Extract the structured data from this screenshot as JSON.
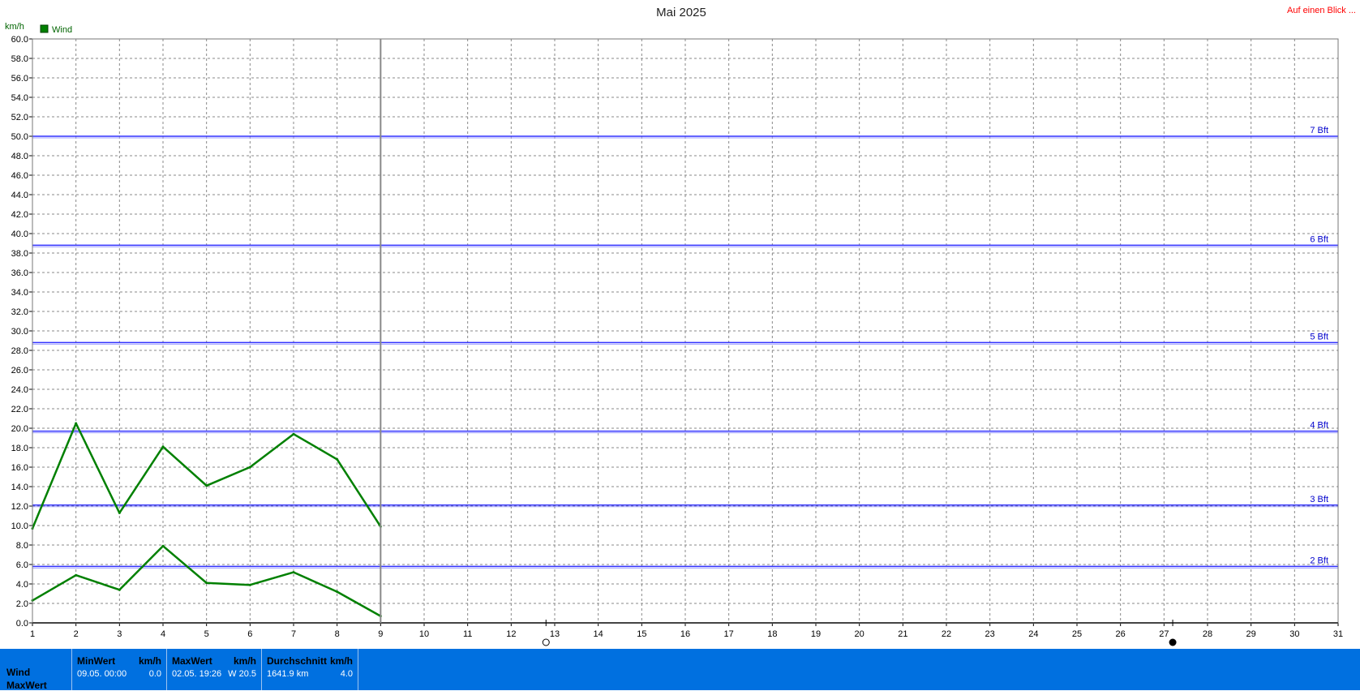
{
  "page": {
    "link_text": "Auf einen Blick ..."
  },
  "chart_data": {
    "type": "line",
    "title": "Mai 2025",
    "ylabel": "km/h",
    "ylim": [
      0,
      60
    ],
    "ytick_step": 2,
    "xlim": [
      1,
      31
    ],
    "x_ticks": [
      1,
      2,
      3,
      4,
      5,
      6,
      7,
      8,
      9,
      10,
      11,
      12,
      13,
      14,
      15,
      16,
      17,
      18,
      19,
      20,
      21,
      22,
      23,
      24,
      25,
      26,
      27,
      28,
      29,
      30,
      31
    ],
    "grid": true,
    "legend": {
      "position": "top-left",
      "entries": [
        "Wind"
      ]
    },
    "series_color": "#008000",
    "series": [
      {
        "name": "Wind",
        "role": "max",
        "x": [
          1,
          2,
          3,
          4,
          5,
          6,
          7,
          8,
          9
        ],
        "values": [
          9.7,
          20.5,
          11.3,
          18.1,
          14.1,
          16.0,
          19.4,
          16.8,
          9.9
        ]
      },
      {
        "role": "avg",
        "x": [
          1,
          2,
          3,
          4,
          5,
          6,
          7,
          8,
          9
        ],
        "values": [
          2.3,
          4.9,
          3.4,
          7.9,
          4.1,
          3.9,
          5.2,
          3.2,
          0.7
        ]
      }
    ],
    "current_day": 9,
    "reference_lines": [
      {
        "value": 5.8,
        "label": "2 Bft"
      },
      {
        "value": 12.1,
        "label": "3 Bft"
      },
      {
        "value": 19.7,
        "label": "4 Bft"
      },
      {
        "value": 28.8,
        "label": "5 Bft"
      },
      {
        "value": 38.8,
        "label": "6 Bft"
      },
      {
        "value": 50.0,
        "label": "7 Bft"
      }
    ],
    "moon_phases": [
      {
        "day": 12.8,
        "phase": "full-moon"
      },
      {
        "day": 27.2,
        "phase": "new-moon"
      }
    ]
  },
  "stats": {
    "row_labels": [
      "Wind",
      "MaxWert"
    ],
    "boxes": [
      {
        "header_left": "MinWert",
        "header_right": "km/h",
        "value_left": "09.05.  00:00",
        "value_right": "0.0"
      },
      {
        "header_left": "MaxWert",
        "header_right": "km/h",
        "value_left": "02.05.  19:26",
        "value_right": "W 20.5"
      },
      {
        "header_left": "Durchschnitt",
        "header_right": "km/h",
        "value_left": "1641.9 km",
        "value_right": "4.0"
      }
    ]
  }
}
